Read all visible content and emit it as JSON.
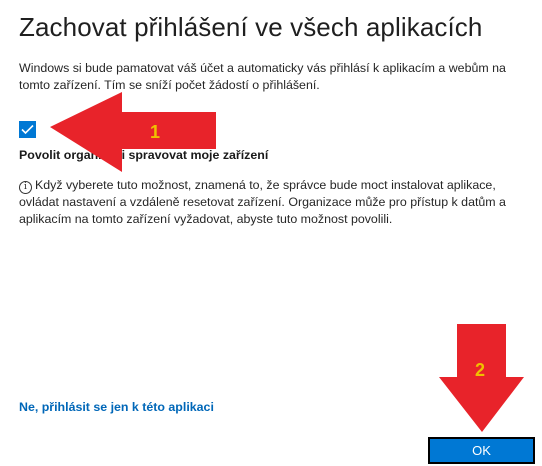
{
  "dialog": {
    "title": "Zachovat přihlášení ve všech aplikacích",
    "description": "Windows si bude pamatovat váš účet a automaticky vás přihlásí k aplikacím a webům na tomto zařízení. Tím se sníží počet žádostí o přihlášení.",
    "checkbox": {
      "checked": true,
      "label": "Povolit organizaci spravovat moje zařízení"
    },
    "info_icon_glyph": "i",
    "info_text": "Když vyberete tuto možnost, znamená to, že správce bude moct instalovat aplikace, ovládat nastavení a vzdáleně resetovat zařízení. Organizace může pro přístup k datům a aplikacím na tomto zařízení vyžadovat, abyste tuto možnost povolili.",
    "link_label": "Ne, přihlásit se jen k této aplikaci",
    "ok_label": "OK"
  },
  "annotations": {
    "arrow_color": "#e8232a",
    "number_color": "#f0c000",
    "arrow_1_label": "1",
    "arrow_2_label": "2"
  },
  "colors": {
    "accent": "#0078d4",
    "link": "#0067b8"
  }
}
